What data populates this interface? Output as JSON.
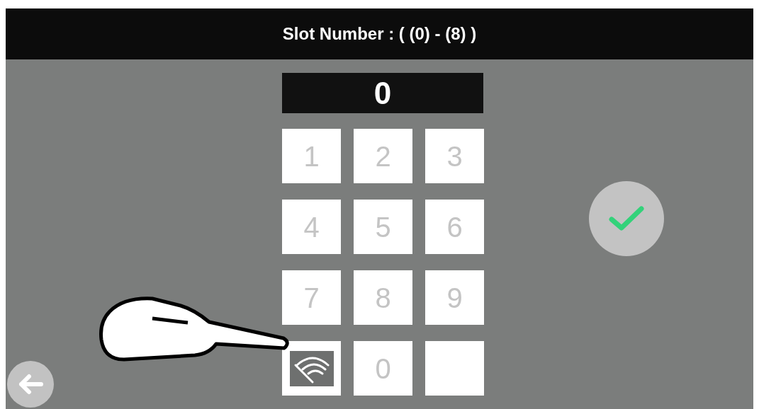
{
  "header": {
    "title": "Slot Number : ( (0) - (8) )"
  },
  "display": {
    "value": "0"
  },
  "keypad": [
    {
      "kind": "digit",
      "label": "1"
    },
    {
      "kind": "digit",
      "label": "2"
    },
    {
      "kind": "digit",
      "label": "3"
    },
    {
      "kind": "digit",
      "label": "4"
    },
    {
      "kind": "digit",
      "label": "5"
    },
    {
      "kind": "digit",
      "label": "6"
    },
    {
      "kind": "digit",
      "label": "7"
    },
    {
      "kind": "digit",
      "label": "8"
    },
    {
      "kind": "digit",
      "label": "9"
    },
    {
      "kind": "wireless"
    },
    {
      "kind": "digit",
      "label": "0"
    },
    {
      "kind": "blank"
    }
  ]
}
